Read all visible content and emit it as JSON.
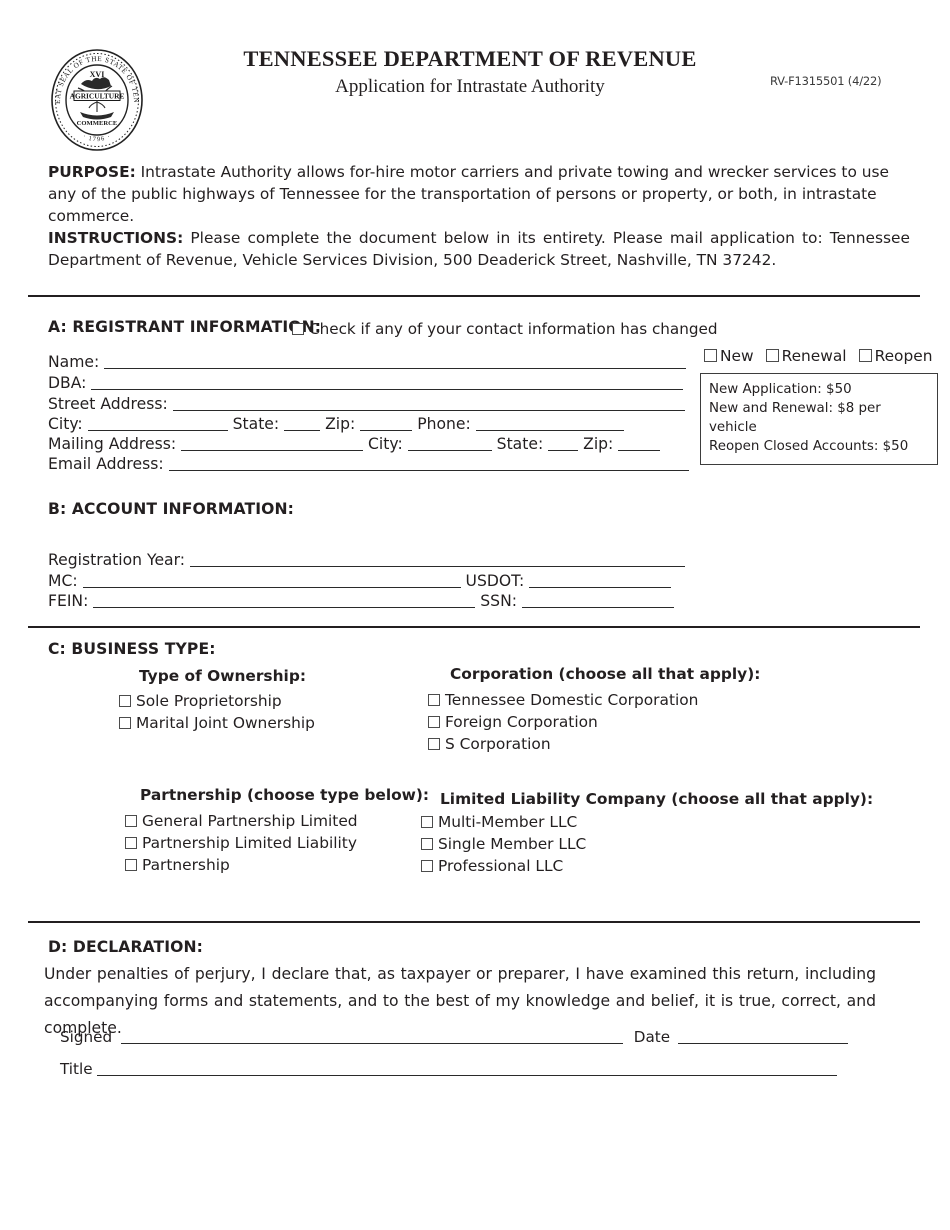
{
  "header": {
    "seal_icon": "tennessee-state-seal",
    "seal_text_outer": "THE GREAT SEAL OF THE STATE OF TENNESSEE",
    "seal_text_agriculture": "AGRICULTURE",
    "seal_text_commerce": "COMMERCE",
    "seal_roman": "XVI",
    "seal_year": "1796",
    "department_title": "TENNESSEE DEPARTMENT OF REVENUE",
    "form_subtitle": "Application for Intrastate Authority",
    "form_number": "RV-F1315501 (4/22)"
  },
  "intro": {
    "purpose_label": "PURPOSE:",
    "purpose_text": " Intrastate Authority allows for-hire motor carriers and private towing and wrecker services to use any of the public highways of Tennessee for the transportation of persons or property, or both, in intrastate commerce.",
    "instructions_label": "INSTRUCTIONS:",
    "instructions_text": " Please complete the document below in its entirety. Please mail application to: Tennessee Department of Revenue, Vehicle Services Division, 500 Deaderick Street, Nashville, TN 37242."
  },
  "section_a": {
    "heading": "A: REGISTRANT INFORMATION:",
    "changed_checkbox_label": "Check if any of your contact information has changed",
    "fields": {
      "name": "Name:",
      "dba": "DBA:",
      "street_address": "Street  Address:",
      "city": "City:",
      "state": "State:",
      "zip": "Zip:",
      "phone": "Phone:",
      "mailing_address": "Mailing Address:",
      "mailing_city": "City:",
      "mailing_state": "State:",
      "mailing_zip": "Zip:",
      "email_address": "Email Address:"
    },
    "application_types": [
      "New",
      "Renewal",
      "Reopen"
    ],
    "fee_box": [
      "New Application: $50",
      "New and Renewal: $8 per vehicle",
      "Reopen Closed Accounts: $50"
    ]
  },
  "section_b": {
    "heading": "B: ACCOUNT INFORMATION:",
    "fields": {
      "registration_year": "Registration Year:",
      "mc": "MC:",
      "usdot": "USDOT:",
      "fein": "FEIN:",
      "ssn": "SSN:"
    }
  },
  "section_c": {
    "heading": "C: BUSINESS TYPE:",
    "groups": [
      {
        "title": "Type of Ownership:",
        "options": [
          "Sole Proprietorship",
          "Marital Joint Ownership"
        ]
      },
      {
        "title": "Corporation (choose all that apply):",
        "options": [
          "Tennessee Domestic Corporation",
          "Foreign Corporation",
          "S Corporation"
        ]
      },
      {
        "title": "Partnership (choose type below):",
        "options": [
          "General Partnership Limited",
          "Partnership Limited Liability",
          "Partnership"
        ]
      },
      {
        "title": "Limited Liability Company (choose all that apply):",
        "options": [
          "Multi-Member LLC",
          "Single Member LLC",
          "Professional LLC"
        ]
      }
    ]
  },
  "section_d": {
    "heading": "D: DECLARATION:",
    "text": "Under penalties of perjury, I declare that, as taxpayer or preparer, I have examined this return, including accompanying forms and statements, and to the best of my knowledge and belief, it is true, correct, and complete.",
    "signed_label": "Signed",
    "date_label": "Date",
    "title_label": "Title"
  }
}
